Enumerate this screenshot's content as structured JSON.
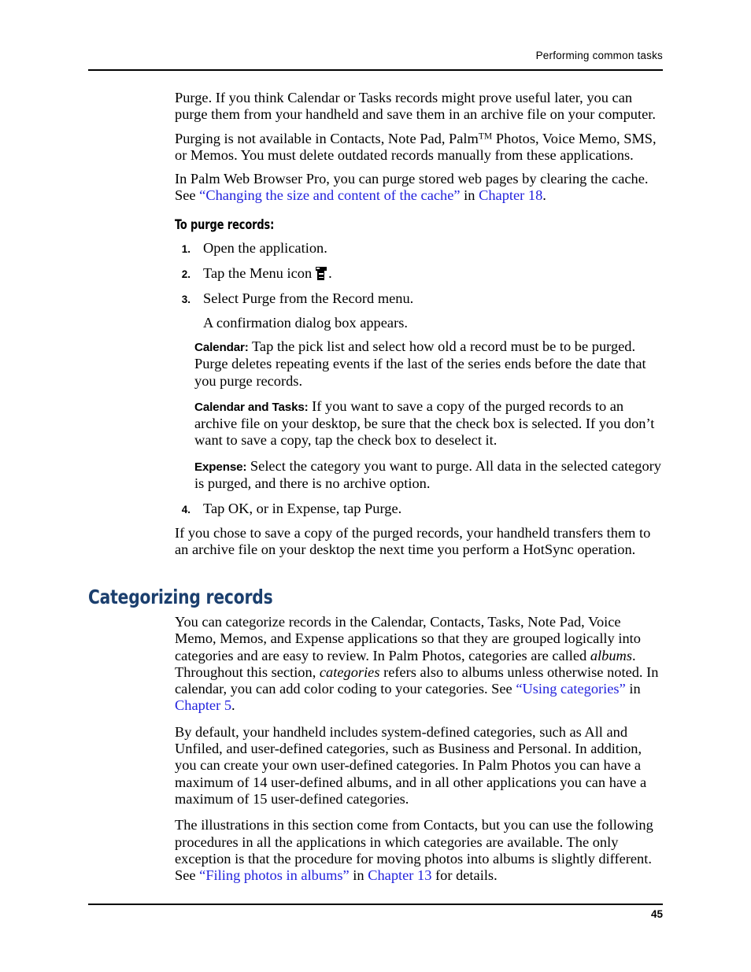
{
  "header": {
    "running_title": "Performing common tasks"
  },
  "footer": {
    "page_number": "45"
  },
  "colors": {
    "link": "#2222dd",
    "section_heading": "#1b3f6e",
    "text": "#000000",
    "background": "#ffffff"
  },
  "body": {
    "p1": "Purge. If you think Calendar or Tasks records might prove useful later, you can purge them from your handheld and save them in an archive file on your computer.",
    "p2_a": "Purging is not available in Contacts, Note Pad, Palm",
    "p2_tm": "TM",
    "p2_b": " Photos, Voice Memo, SMS, or Memos. You must delete outdated records manually from these applications.",
    "p3_a": "In Palm Web Browser Pro, you can purge stored web pages by clearing the cache. See ",
    "p3_link1": "“Changing the size and content of the cache”",
    "p3_mid": " in ",
    "p3_link2": "Chapter 18",
    "p3_end": "."
  },
  "procedure": {
    "heading": "To purge records:",
    "steps": [
      {
        "num": "1.",
        "text": "Open the application."
      },
      {
        "num": "2.",
        "text_before": "Tap the Menu icon",
        "icon": "menu-icon",
        "text_after": "."
      },
      {
        "num": "3.",
        "text": "Select Purge from the Record menu."
      },
      {
        "num": "4.",
        "text": "Tap OK, or in Expense, tap Purge."
      }
    ],
    "step3_note": "A confirmation dialog box appears.",
    "definitions": [
      {
        "term": "Calendar:",
        "text": " Tap the pick list and select how old a record must be to be purged. Purge deletes repeating events if the last of the series ends before the date that you purge records."
      },
      {
        "term": "Calendar and Tasks:",
        "text": " If you want to save a copy of the purged records to an archive file on your desktop, be sure that the check box is selected. If you don’t want to save a copy, tap the check box to deselect it."
      },
      {
        "term": "Expense:",
        "text": " Select the category you want to purge. All data in the selected category is purged, and there is no archive option."
      }
    ],
    "closing": "If you chose to save a copy of the purged records, your handheld transfers them to an archive file on your desktop the next time you perform a HotSync operation."
  },
  "section": {
    "heading": "Categorizing records",
    "p1_a": "You can categorize records in the Calendar, Contacts, Tasks, Note Pad, Voice Memo, Memos, and Expense applications so that they are grouped logically into categories and are easy to review. In Palm Photos, categories are called ",
    "p1_ital1": "albums",
    "p1_b": ". Throughout this section, ",
    "p1_ital2": "categories",
    "p1_c": " refers also to albums unless otherwise noted. In calendar, you can add color coding to your categories. See ",
    "p1_link1": "“Using categories”",
    "p1_d": " in ",
    "p1_link2": "Chapter 5",
    "p1_e": ".",
    "p2": "By default, your handheld includes system-defined categories, such as All and Unfiled, and user-defined categories, such as Business and Personal. In addition, you can create your own user-defined categories. In Palm Photos you can have a maximum of 14 user-defined albums, and in all other applications you can have a maximum of 15 user-defined categories.",
    "p3_a": "The illustrations in this section come from Contacts, but you can use the following procedures in all the applications in which categories are available. The only exception is that the procedure for moving photos into albums is slightly different. See ",
    "p3_link1": "“Filing photos in albums”",
    "p3_b": " in ",
    "p3_link2": "Chapter 13",
    "p3_c": " for details."
  }
}
